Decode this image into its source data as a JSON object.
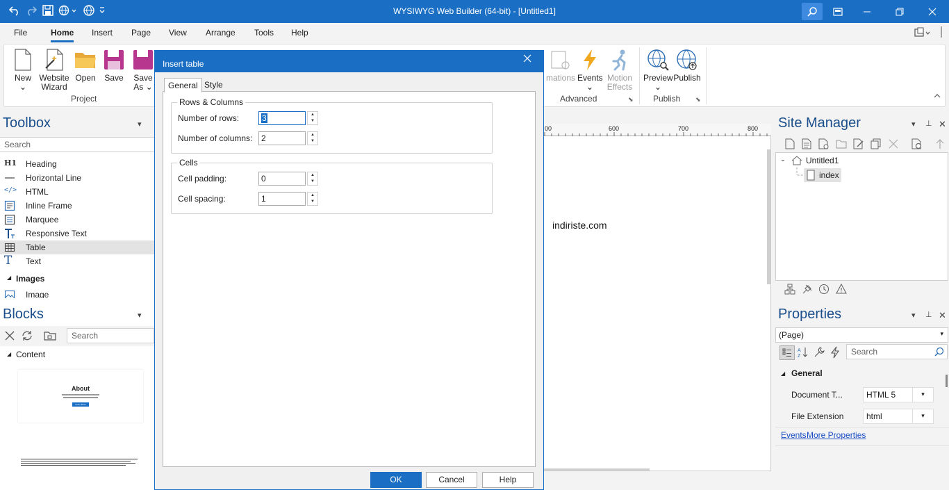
{
  "window": {
    "title": "WYSIWYG Web Builder (64-bit) - [Untitled1]"
  },
  "menu": [
    "File",
    "Home",
    "Insert",
    "Page",
    "View",
    "Arrange",
    "Tools",
    "Help"
  ],
  "ribbon": {
    "project": {
      "label": "Project",
      "buttons": [
        {
          "label": "New",
          "sub": "⌄"
        },
        {
          "label": "Website",
          "sub": "Wizard"
        },
        {
          "label": "Open",
          "sub": ""
        },
        {
          "label": "Save",
          "sub": ""
        },
        {
          "label": "Save",
          "sub": "As ⌄"
        }
      ]
    },
    "advanced": {
      "label": "Advanced",
      "buttons": [
        {
          "label": "mations",
          "sub": ""
        },
        {
          "label": "Events",
          "sub": "⌄"
        },
        {
          "label": "Motion",
          "sub": "Effects"
        }
      ]
    },
    "publish": {
      "label": "Publish",
      "buttons": [
        {
          "label": "Preview",
          "sub": "⌄"
        },
        {
          "label": "Publish",
          "sub": ""
        }
      ]
    }
  },
  "toolbox": {
    "title": "Toolbox",
    "search_placeholder": "Search",
    "items": [
      {
        "label": "Heading",
        "icon_text": "H1"
      },
      {
        "label": "Horizontal Line"
      },
      {
        "label": "HTML",
        "icon_text": "</>"
      },
      {
        "label": "Inline Frame"
      },
      {
        "label": "Marquee"
      },
      {
        "label": "Responsive Text"
      },
      {
        "label": "Table"
      },
      {
        "label": "Text",
        "icon_text": "T"
      }
    ],
    "images_group": "Images",
    "image_item": "Image"
  },
  "blocks": {
    "title": "Blocks",
    "search_placeholder": "Search",
    "category": "Content",
    "thumb1_title": "About",
    "thumb1_button": "Learn More"
  },
  "canvas": {
    "ruler_labels": [
      "00",
      "600",
      "700",
      "800"
    ],
    "text": "indiriste.com"
  },
  "site_manager": {
    "title": "Site Manager",
    "site": "Untitled1",
    "page": "index"
  },
  "properties": {
    "title": "Properties",
    "selector": "(Page)",
    "search_placeholder": "Search",
    "group": "General",
    "rows": [
      {
        "label": "Document T...",
        "value": "HTML 5"
      },
      {
        "label": "File Extension",
        "value": "html"
      }
    ],
    "links": [
      "Events",
      "More Properties"
    ]
  },
  "dialog": {
    "title": "Insert table",
    "tabs": [
      "General",
      "Style"
    ],
    "rows_columns": {
      "legend": "Rows & Columns",
      "rows_label": "Number of rows:",
      "rows_value": "3",
      "columns_label": "Number of columns:",
      "columns_value": "2"
    },
    "cells": {
      "legend": "Cells",
      "padding_label": "Cell padding:",
      "padding_value": "0",
      "spacing_label": "Cell spacing:",
      "spacing_value": "1"
    },
    "buttons": {
      "ok": "OK",
      "cancel": "Cancel",
      "help": "Help"
    }
  }
}
